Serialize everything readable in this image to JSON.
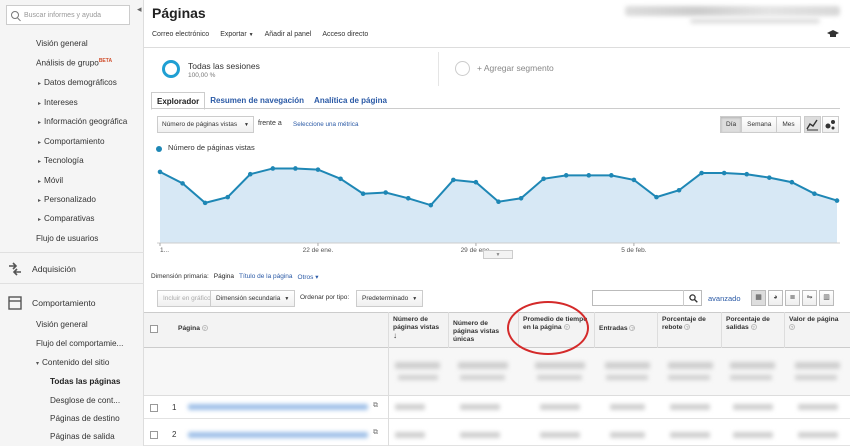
{
  "sidebar": {
    "search_placeholder": "Buscar informes y ayuda",
    "items": [
      {
        "label": "Visión general",
        "top": 39
      },
      {
        "label": "Análisis de grupo",
        "badge": "BETA",
        "top": 58
      },
      {
        "label": "Datos demográficos",
        "arrow": true,
        "top": 78
      },
      {
        "label": "Intereses",
        "arrow": true,
        "top": 98
      },
      {
        "label": "Información geográfica",
        "arrow": true,
        "top": 117
      },
      {
        "label": "Comportamiento",
        "arrow": true,
        "top": 137
      },
      {
        "label": "Tecnología",
        "arrow": true,
        "top": 156
      },
      {
        "label": "Móvil",
        "arrow": true,
        "top": 176
      },
      {
        "label": "Personalizado",
        "arrow": true,
        "top": 195
      },
      {
        "label": "Comparativas",
        "arrow": true,
        "top": 214
      },
      {
        "label": "Flujo de usuarios",
        "top": 234
      }
    ],
    "acquisition": "Adquisición",
    "behavior": "Comportamiento",
    "behavior_items": {
      "overview": "Visión general",
      "flow": "Flujo del comportamie...",
      "site_content": "Contenido del sitio",
      "all_pages": "Todas las páginas",
      "drilldown": "Desglose de cont...",
      "landing": "Páginas de destino",
      "exit": "Páginas de salida"
    }
  },
  "header": {
    "title": "Páginas",
    "toolbar": [
      "Correo electrónico",
      "Exportar",
      "Añadir al panel",
      "Acceso directo"
    ]
  },
  "segments": {
    "name": "Todas las sesiones",
    "pct": "100,00 %",
    "add": "+ Agregar segmento"
  },
  "tabs": [
    "Explorador",
    "Resumen de navegación",
    "Analítica de página"
  ],
  "controls": {
    "metric": "Número de páginas vistas",
    "vs": "frente a",
    "select_metric": "Seleccione una métrica",
    "periods": [
      "Día",
      "Semana",
      "Mes"
    ],
    "active_period": "Día"
  },
  "chart_data": {
    "type": "area",
    "series": [
      {
        "name": "Número de páginas vistas",
        "values": [
          62,
          52,
          35,
          40,
          60,
          65,
          65,
          64,
          56,
          43,
          44,
          39,
          33,
          55,
          53,
          36,
          39,
          56,
          59,
          59,
          59,
          55,
          40,
          46,
          61,
          61,
          60,
          57,
          53,
          43,
          37
        ]
      }
    ],
    "x_tick_labels": [
      "1...",
      "22 de ene.",
      "29 de ene.",
      "5 de feb."
    ],
    "ylim": [
      0,
      75
    ],
    "grid": false,
    "color": "#1e87b5",
    "fill": "#d7e8f5"
  },
  "table_controls": {
    "primary_dimension_label": "Dimensión primaria:",
    "dimensions": [
      "Página",
      "Título de la página",
      "Otros"
    ],
    "plot_rows": "Incluir en gráfico",
    "secondary_dimension": "Dimensión secundaria",
    "sort_label": "Ordenar por tipo:",
    "sort_value": "Predeterminado",
    "advanced": "avanzado"
  },
  "table": {
    "columns": [
      "Página",
      "Número de páginas vistas",
      "Número de páginas vistas únicas",
      "Promedio de tiempo en la página",
      "Entradas",
      "Porcentaje de rebote",
      "Porcentaje de salidas",
      "Valor de página"
    ],
    "rows": [
      "1",
      "2"
    ]
  }
}
